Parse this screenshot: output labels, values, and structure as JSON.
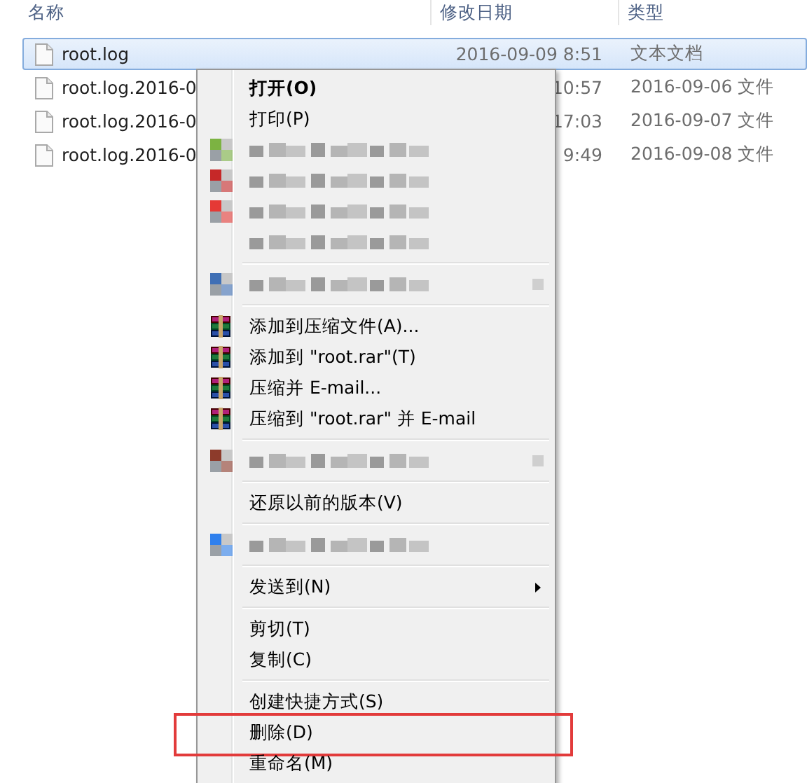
{
  "columns": [
    {
      "label": "名称"
    },
    {
      "label": "修改日期"
    },
    {
      "label": "类型"
    }
  ],
  "files": [
    {
      "name": "root.log",
      "date": "2016-09-09 8:51",
      "type": "文本文档",
      "selected": true
    },
    {
      "name": "root.log.2016-0",
      "date": "10:57",
      "type": "2016-09-06 文件",
      "selected": false
    },
    {
      "name": "root.log.2016-0",
      "date": "17:03",
      "type": "2016-09-07 文件",
      "selected": false
    },
    {
      "name": "root.log.2016-0",
      "date": "9:49",
      "type": "2016-09-08 文件",
      "selected": false
    }
  ],
  "context_menu": {
    "groups": [
      [
        {
          "kind": "command",
          "label": "打开(O)",
          "default": true
        },
        {
          "kind": "command",
          "label": "打印(P)",
          "default": false
        },
        {
          "kind": "blurred",
          "color": "#7cb342",
          "submenu": false
        },
        {
          "kind": "blurred",
          "color": "#c62828",
          "submenu": false
        },
        {
          "kind": "blurred",
          "color": "#e53935",
          "submenu": false
        },
        {
          "kind": "blurred",
          "submenu": false
        }
      ],
      [
        {
          "kind": "blurred",
          "color": "#3f6fb5",
          "submenu": true
        }
      ],
      [
        {
          "kind": "archive",
          "label": "添加到压缩文件(A)..."
        },
        {
          "kind": "archive",
          "label": "添加到 \"root.rar\"(T)"
        },
        {
          "kind": "archive",
          "label": "压缩并 E-mail..."
        },
        {
          "kind": "archive",
          "label": "压缩到 \"root.rar\" 并 E-mail"
        }
      ],
      [
        {
          "kind": "blurred",
          "color": "#8d3b2b",
          "submenu": true
        }
      ],
      [
        {
          "kind": "command",
          "label": "还原以前的版本(V)",
          "default": false
        }
      ],
      [
        {
          "kind": "blurred",
          "color": "#2f80ed",
          "submenu": false
        }
      ],
      [
        {
          "kind": "command",
          "label": "发送到(N)",
          "default": false,
          "submenu": true
        }
      ],
      [
        {
          "kind": "command",
          "label": "剪切(T)",
          "default": false
        },
        {
          "kind": "command",
          "label": "复制(C)",
          "default": false
        }
      ],
      [
        {
          "kind": "command",
          "label": "创建快捷方式(S)",
          "default": false
        },
        {
          "kind": "command",
          "label": "删除(D)",
          "default": false,
          "highlighted": true
        },
        {
          "kind": "command",
          "label": "重命名(M)",
          "default": false
        }
      ]
    ]
  }
}
